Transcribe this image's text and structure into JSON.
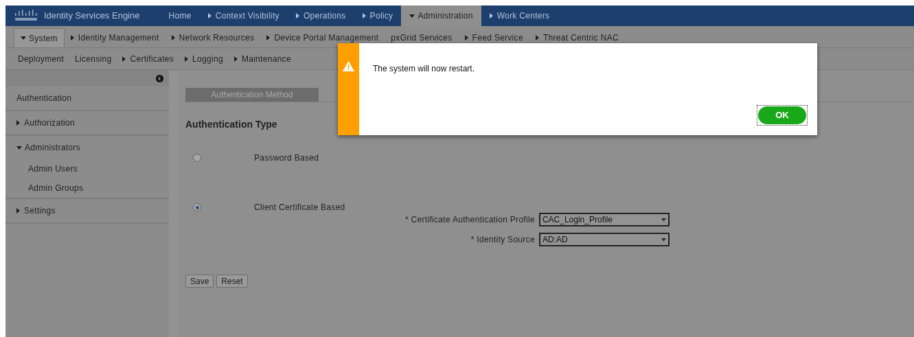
{
  "header": {
    "product": "Identity Services Engine",
    "tabs": [
      {
        "label": "Home",
        "kind": "plain",
        "selected": false
      },
      {
        "label": "Context Visibility",
        "kind": "collapsed",
        "selected": false
      },
      {
        "label": "Operations",
        "kind": "collapsed",
        "selected": false
      },
      {
        "label": "Policy",
        "kind": "collapsed",
        "selected": false
      },
      {
        "label": "Administration",
        "kind": "expanded",
        "selected": true
      },
      {
        "label": "Work Centers",
        "kind": "collapsed",
        "selected": false
      }
    ]
  },
  "subtabs": [
    {
      "label": "System",
      "kind": "expanded",
      "selected": true
    },
    {
      "label": "Identity Management",
      "kind": "collapsed",
      "selected": false
    },
    {
      "label": "Network Resources",
      "kind": "collapsed",
      "selected": false
    },
    {
      "label": "Device Portal Management",
      "kind": "collapsed",
      "selected": false
    },
    {
      "label": "pxGrid Services",
      "kind": "plain",
      "selected": false
    },
    {
      "label": "Feed Service",
      "kind": "collapsed",
      "selected": false
    },
    {
      "label": "Threat Centric NAC",
      "kind": "collapsed",
      "selected": false
    }
  ],
  "menu": [
    {
      "label": "Deployment",
      "kind": "plain"
    },
    {
      "label": "Licensing",
      "kind": "plain"
    },
    {
      "label": "Certificates",
      "kind": "collapsed"
    },
    {
      "label": "Logging",
      "kind": "collapsed"
    },
    {
      "label": "Maintenance",
      "kind": "collapsed"
    }
  ],
  "sidebar": {
    "items": [
      {
        "label": "Authentication",
        "kind": "plain"
      },
      {
        "label": "Authorization",
        "kind": "collapsed"
      },
      {
        "label": "Administrators",
        "kind": "expanded",
        "children": [
          {
            "label": "Admin Users"
          },
          {
            "label": "Admin Groups"
          }
        ]
      },
      {
        "label": "Settings",
        "kind": "collapsed"
      }
    ]
  },
  "content": {
    "tab": "Authentication Method",
    "heading": "Authentication Type",
    "options": [
      {
        "label": "Password Based",
        "selected": false
      },
      {
        "label": "Client Certificate Based",
        "selected": true
      }
    ],
    "fields": [
      {
        "label": "* Certificate Authentication Profile",
        "value": "CAC_Login_Profile"
      },
      {
        "label": "* Identity Source",
        "value": "AD:AD"
      }
    ],
    "buttons": [
      "Save",
      "Reset"
    ]
  },
  "dialog": {
    "message": "The system will now restart.",
    "button": "OK"
  }
}
